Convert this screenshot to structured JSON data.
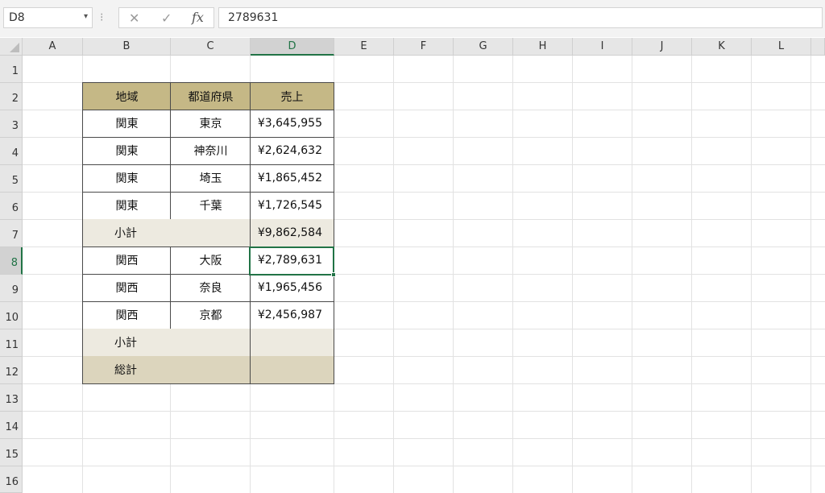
{
  "formula_bar": {
    "name_box": "D8",
    "name_box_arrow": "▾",
    "separator": "⁝",
    "cancel_icon": "✕",
    "enter_icon": "✓",
    "fx_label": "fx",
    "formula_value": "2789631"
  },
  "columns": [
    "A",
    "B",
    "C",
    "D",
    "E",
    "F",
    "G",
    "H",
    "I",
    "J",
    "K",
    "L"
  ],
  "rows": [
    "1",
    "2",
    "3",
    "4",
    "5",
    "6",
    "7",
    "8",
    "9",
    "10",
    "11",
    "12",
    "13",
    "14",
    "15",
    "16"
  ],
  "selected_cell": "D8",
  "table": {
    "headers": {
      "region": "地域",
      "prefecture": "都道府県",
      "sales": "売上"
    },
    "r3": {
      "region": "関東",
      "prefecture": "東京",
      "sales": "¥3,645,955"
    },
    "r4": {
      "region": "関東",
      "prefecture": "神奈川",
      "sales": "¥2,624,632"
    },
    "r5": {
      "region": "関東",
      "prefecture": "埼玉",
      "sales": "¥1,865,452"
    },
    "r6": {
      "region": "関東",
      "prefecture": "千葉",
      "sales": "¥1,726,545"
    },
    "r7": {
      "label": "小計",
      "sales": "¥9,862,584"
    },
    "r8": {
      "region": "関西",
      "prefecture": "大阪",
      "sales": "¥2,789,631"
    },
    "r9": {
      "region": "関西",
      "prefecture": "奈良",
      "sales": "¥1,965,456"
    },
    "r10": {
      "region": "関西",
      "prefecture": "京都",
      "sales": "¥2,456,987"
    },
    "r11": {
      "label": "小計",
      "sales": ""
    },
    "r12": {
      "label": "総計",
      "sales": ""
    }
  },
  "colors": {
    "header_fill": "#c5b886",
    "subtotal_fill": "#edeae0",
    "total_fill": "#dcd5bd",
    "selection": "#217346"
  }
}
